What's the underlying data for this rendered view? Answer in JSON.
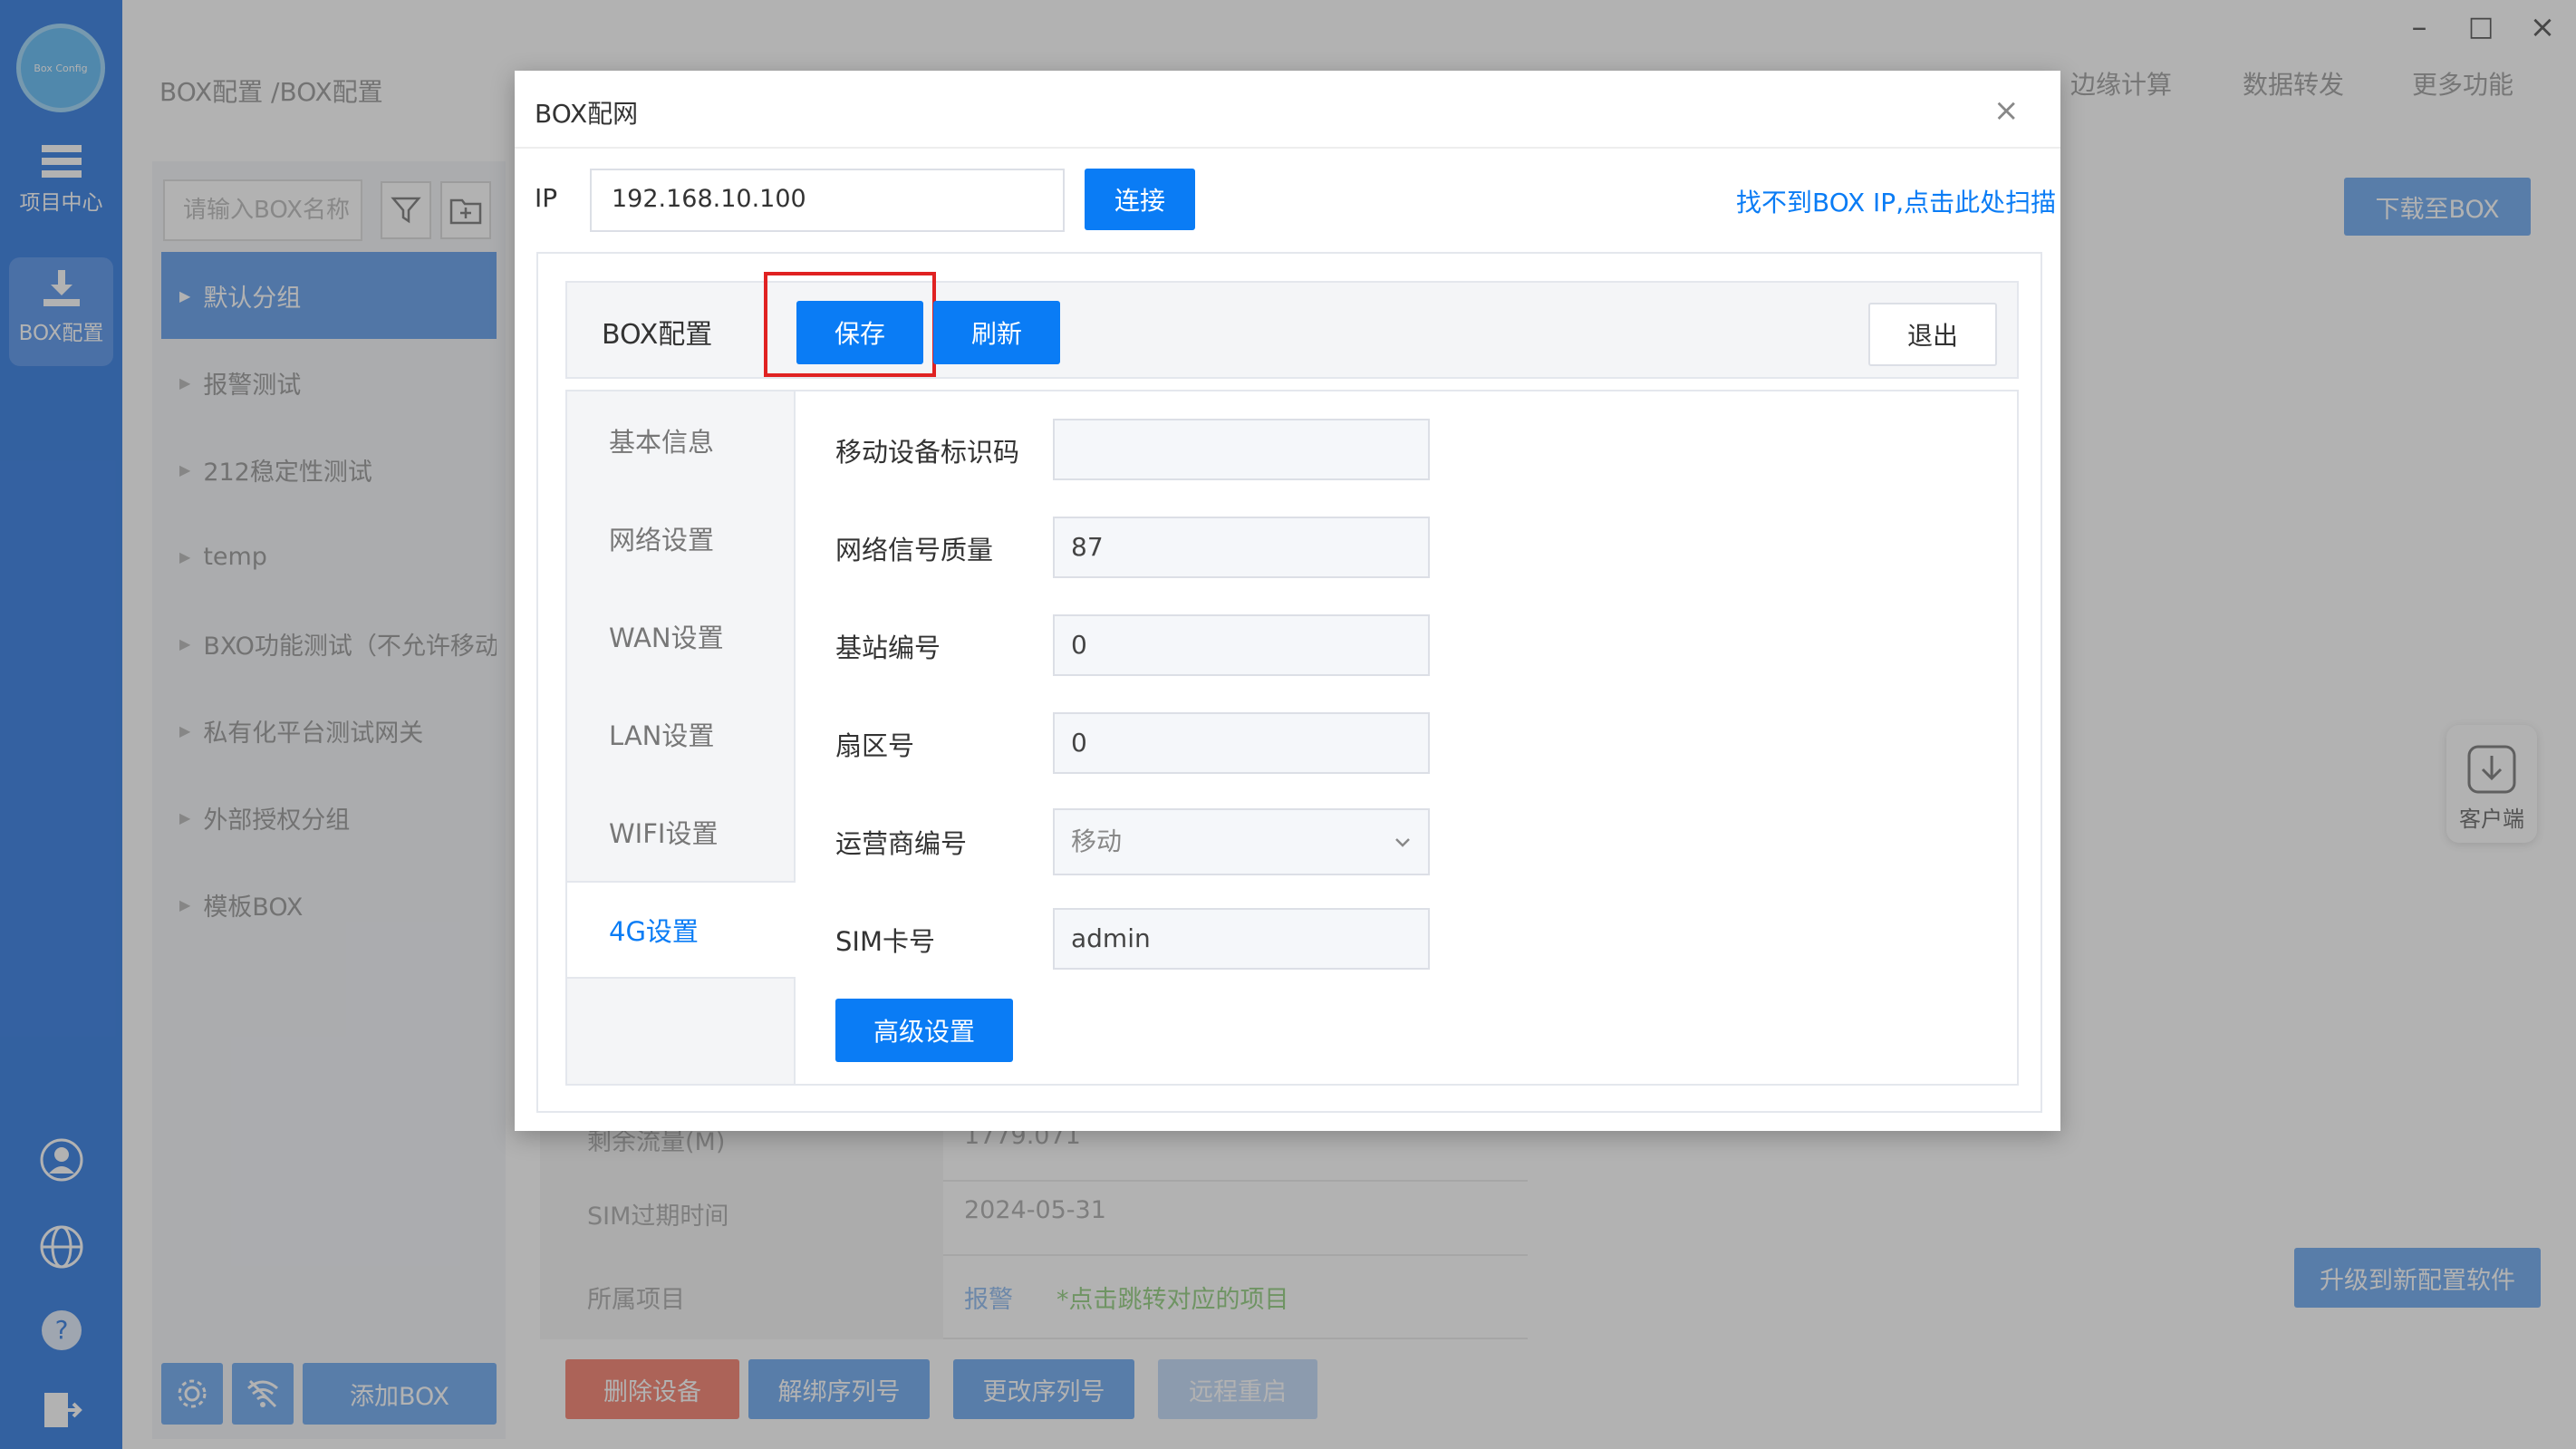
{
  "rail": {
    "logo_text": "Box Config",
    "items": [
      {
        "label": "项目中心",
        "icon": "list-icon"
      },
      {
        "label": "BOX配置",
        "icon": "download-icon"
      }
    ],
    "bottom_icons": [
      "user-icon",
      "globe-icon",
      "help-icon",
      "logout-icon"
    ]
  },
  "header": {
    "breadcrumb": "BOX配置 /BOX配置",
    "tabs": [
      "边缘计算",
      "数据转发",
      "更多功能"
    ]
  },
  "window_controls": [
    "minimize-icon",
    "maximize-icon",
    "close-icon"
  ],
  "left_panel": {
    "search_placeholder": "请输入BOX名称",
    "groups": [
      "默认分组",
      "报警测试",
      "212稳定性测试",
      "temp",
      "BXO功能测试（不允许移动）",
      "私有化平台测试网关",
      "外部授权分组",
      "模板BOX"
    ],
    "add_box_label": "添加BOX"
  },
  "right_side": {
    "download_label": "下载至BOX",
    "client_label": "客户端",
    "upgrade_label": "升级到新配置软件"
  },
  "bg_info": {
    "rows": [
      {
        "key": "剩余流量(M)",
        "value": "1779.071"
      },
      {
        "key": "SIM过期时间",
        "value": "2024-05-31"
      },
      {
        "key": "所属项目",
        "value": "报警",
        "note": "*点击跳转对应的项目"
      }
    ],
    "actions": [
      {
        "label": "删除设备",
        "color": "#f68f7e"
      },
      {
        "label": "解绑序列号",
        "color": "#7fb3f2"
      },
      {
        "label": "更改序列号",
        "color": "#7fb3f2"
      },
      {
        "label": "远程重启",
        "color": "#c9def9"
      }
    ]
  },
  "modal": {
    "title": "BOX配网",
    "ip_label": "IP",
    "ip_value": "192.168.10.100",
    "connect_label": "连接",
    "scan_link": "找不到BOX IP,点击此处扫描",
    "config": {
      "title": "BOX配置",
      "save_label": "保存",
      "refresh_label": "刷新",
      "exit_label": "退出",
      "tabs": [
        "基本信息",
        "网络设置",
        "WAN设置",
        "LAN设置",
        "WIFI设置",
        "4G设置"
      ],
      "active_tab": "4G设置",
      "fields": [
        {
          "label": "移动设备标识码",
          "value": ""
        },
        {
          "label": "网络信号质量",
          "value": "87"
        },
        {
          "label": "基站编号",
          "value": "0"
        },
        {
          "label": "扇区号",
          "value": "0"
        },
        {
          "label": "运营商编号",
          "value": "移动"
        },
        {
          "label": "SIM卡号",
          "value": "admin"
        }
      ],
      "advanced_label": "高级设置"
    }
  },
  "colors": {
    "primary": "#0a7cf5",
    "rail": "#4a8be6",
    "highlight": "#e02222"
  }
}
